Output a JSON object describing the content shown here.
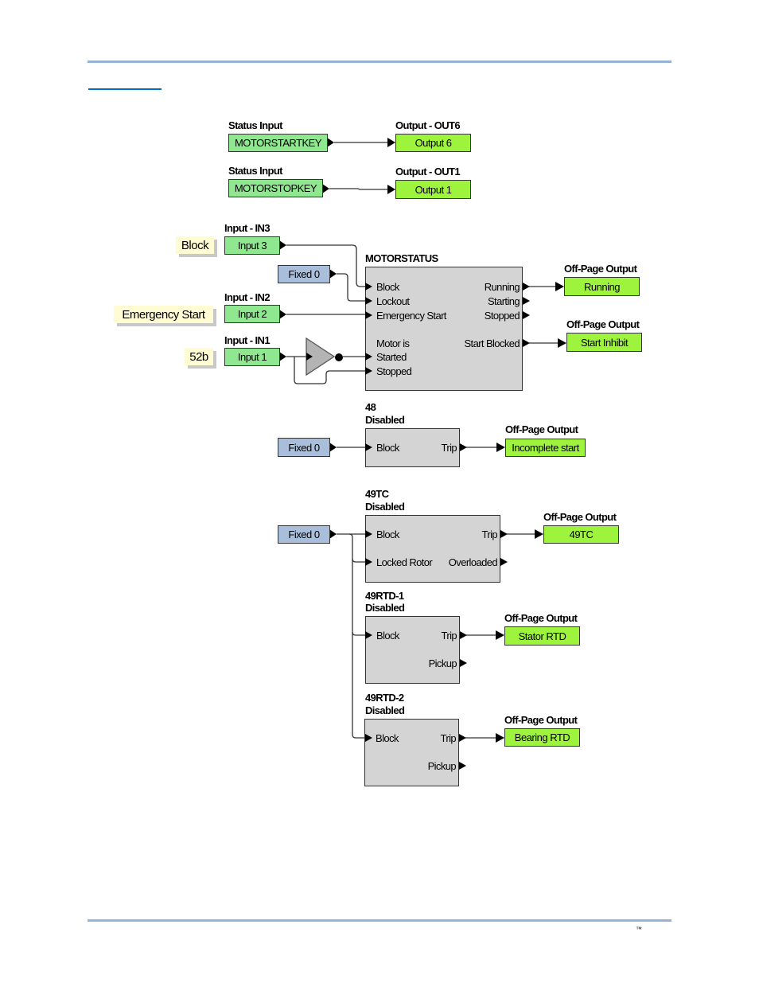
{
  "page": {
    "trademark": "™",
    "colors": {
      "rule": "#95b3d7",
      "link_rule": "#0070c0",
      "input": "#8fe88f",
      "output": "#9ef43c",
      "fixed": "#a9bedb",
      "label": "#fffbd2",
      "block": "#d4d4d4"
    }
  },
  "status1": {
    "title": "Status Input",
    "value": "MOTORSTARTKEY",
    "out_title": "Output - OUT6",
    "out_value": "Output 6"
  },
  "status2": {
    "title": "Status Input",
    "value": "MOTORSTOPKEY",
    "out_title": "Output - OUT1",
    "out_value": "Output 1"
  },
  "inputs": {
    "in3": {
      "title": "Input - IN3",
      "value": "Input 3",
      "label": "Block"
    },
    "in2": {
      "title": "Input - IN2",
      "value": "Input 2",
      "label": "Emergency Start"
    },
    "in1": {
      "title": "Input - IN1",
      "value": "Input 1",
      "label": "52b"
    },
    "fixed": "Fixed 0"
  },
  "motorstatus": {
    "title": "MOTORSTATUS",
    "ports_in": [
      "Block",
      "Lockout",
      "Emergency Start",
      "Motor is",
      "Started",
      "Stopped"
    ],
    "ports_out": [
      "Running",
      "Starting",
      "Stopped",
      "Start Blocked"
    ]
  },
  "offpage": {
    "title": "Off-Page Output",
    "running": "Running",
    "start_inhibit": "Start Inhibit",
    "incomplete": "Incomplete start",
    "t49tc": "49TC",
    "stator": "Stator RTD",
    "bearing": "Bearing RTD"
  },
  "b48": {
    "name": "48",
    "state": "Disabled",
    "in": "Block",
    "out": "Trip"
  },
  "b49tc": {
    "name": "49TC",
    "state": "Disabled",
    "in1": "Block",
    "in2": "Locked Rotor",
    "out1": "Trip",
    "out2": "Overloaded"
  },
  "rtd1": {
    "name": "49RTD-1",
    "state": "Disabled",
    "in": "Block",
    "out1": "Trip",
    "out2": "Pickup"
  },
  "rtd2": {
    "name": "49RTD-2",
    "state": "Disabled",
    "in": "Block",
    "out1": "Trip",
    "out2": "Pickup"
  }
}
